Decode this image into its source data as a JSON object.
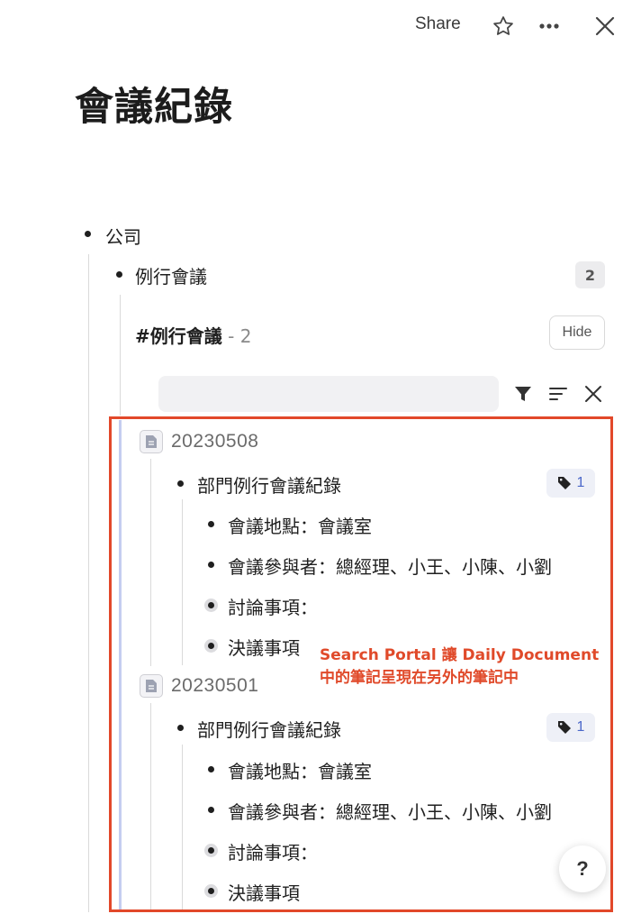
{
  "topbar": {
    "share_label": "Share",
    "icons": [
      "star-icon",
      "more-icon",
      "close-icon"
    ]
  },
  "page": {
    "title": "會議紀錄"
  },
  "tree": {
    "root": "公司",
    "child": "例行會議",
    "child_count": "2",
    "tag_header": {
      "tag": "#例行會議",
      "count": "- 2",
      "hide_label": "Hide"
    },
    "search": {
      "placeholder": ""
    },
    "toolbar_icons": [
      "filter-icon",
      "sort-icon",
      "clear-icon"
    ],
    "entries": [
      {
        "date": "20230508",
        "title": "部門例行會議紀錄",
        "tag_count": "1",
        "items": [
          "會議地點：會議室",
          "會議參與者：總經理、小王、小陳、小劉",
          "討論事項：",
          "決議事項"
        ]
      },
      {
        "date": "20230501",
        "title": "部門例行會議紀錄",
        "tag_count": "1",
        "items": [
          "會議地點：會議室",
          "會議參與者：總經理、小王、小陳、小劉",
          "討論事項：",
          "決議事項"
        ]
      }
    ]
  },
  "annotation": {
    "line1": "Search Portal 讓 Daily Document",
    "line2": "中的筆記呈現在另外的筆記中"
  },
  "help_label": "?",
  "colors": {
    "accent": "#e2482a",
    "tag": "#4a67c9",
    "bar": "#c4cdf0"
  }
}
